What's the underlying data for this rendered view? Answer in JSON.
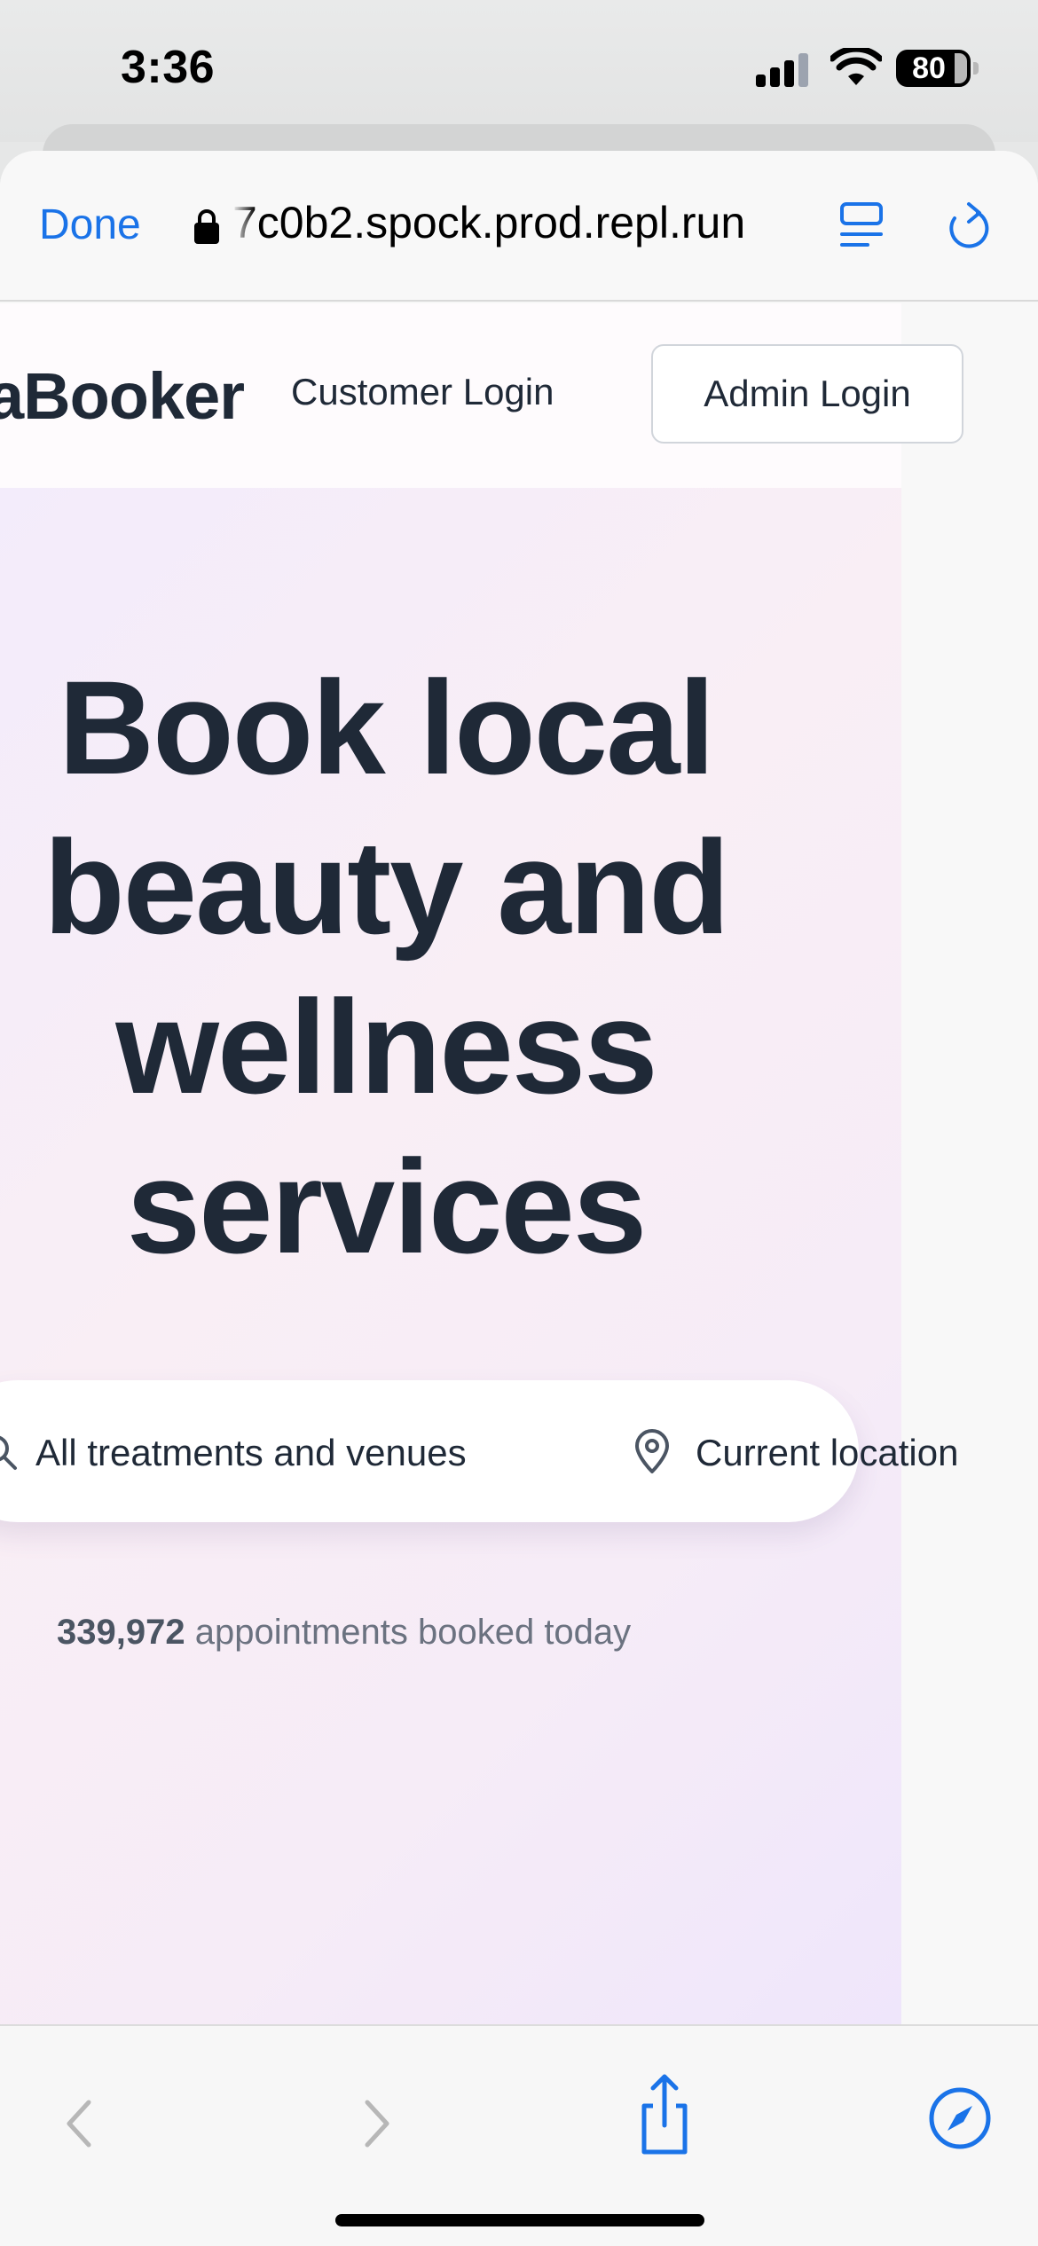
{
  "status_bar": {
    "time": "3:36",
    "battery_percent": "80",
    "battery_level": 0.8,
    "signal_bars_active": 3
  },
  "browser": {
    "done_label": "Done",
    "url": "7c0b2.spock.prod.repl.run",
    "accent_color": "#1a73e8"
  },
  "site": {
    "logo": "aBooker",
    "nav": {
      "customer_login": "Customer Login",
      "admin_login": "Admin Login"
    }
  },
  "hero": {
    "title": "Book local beauty and wellness services",
    "search": {
      "treatments_placeholder": "All treatments and venues",
      "location_placeholder": "Current location"
    },
    "stats": {
      "count": "339,972",
      "suffix": " appointments booked today"
    }
  },
  "icons": {
    "lock": "lock-icon",
    "reader": "reader-icon",
    "reload": "reload-icon",
    "search": "search-icon",
    "location": "map-pin-icon",
    "back": "chevron-left-icon",
    "forward": "chevron-right-icon",
    "share": "share-icon",
    "compass": "compass-icon"
  }
}
